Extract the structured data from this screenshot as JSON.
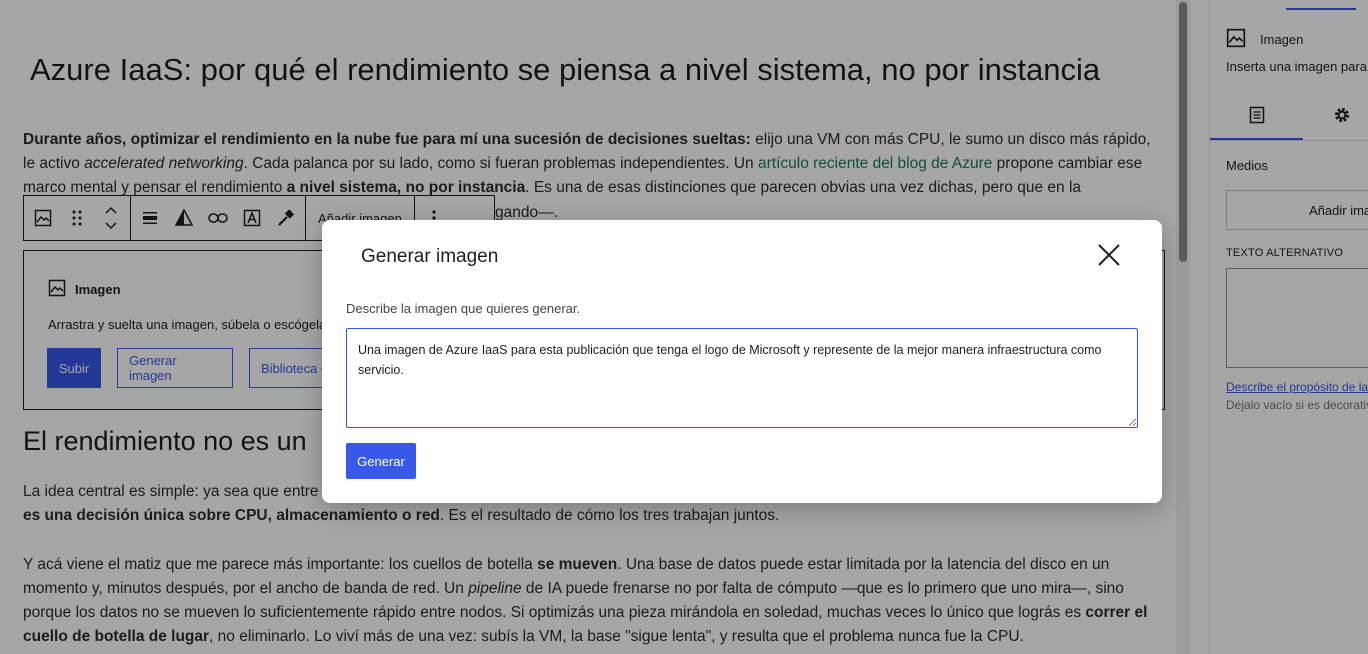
{
  "post": {
    "title": "Azure IaaS: por qué el rendimiento se piensa a nivel sistema, no por instancia",
    "p1": {
      "b1": "Durante años, optimizar el rendimiento en la nube fue para mí una sucesión de decisiones sueltas:",
      "t1": " elijo una VM con más CPU, le sumo un disco más rápido, le activo ",
      "i1": "accelerated networking",
      "t2": ". Cada palanca por su lado, como si fueran problemas independientes. Un ",
      "link": "artículo reciente del blog de Azure",
      "t3": " propone cambiar ese marco mental y pensar el rendimiento ",
      "b2": "a nivel sistema, no por instancia",
      "t4": ". Es una de esas distinciones que parecen obvias una vez dichas, pero que en la"
    },
    "p1_tail": "gando—.",
    "h2": "El rendimiento no es un",
    "p2": {
      "t1": "La idea central es simple: ya sea que entre",
      "b1": "es una decisión única sobre CPU, almacenamiento o red",
      "t2": ". Es el resultado de cómo los tres trabajan juntos."
    },
    "p3": {
      "t1": "Y acá viene el matiz que me parece más importante: los cuellos de botella ",
      "b1": "se mueven",
      "t2": ". Una base de datos puede estar limitada por la latencia del disco en un momento y, minutos después, por el ancho de banda de red. Un ",
      "i1": "pipeline",
      "t3": " de IA puede frenarse no por falta de cómputo —que es lo primero que uno mira—, sino porque los datos no se mueven lo suficientemente rápido entre nodos. Si optimizás una pieza mirándola en soledad, muchas veces lo único que lográs es ",
      "b2": "correr el cuello de botella de lugar",
      "t4": ", no eliminarlo. Lo viví más de una vez: subís la VM, la base \"sigue lenta\", y resulta que el problema nunca fue la CPU."
    }
  },
  "toolbar": {
    "add_image": "Añadir imagen"
  },
  "image_block": {
    "label": "Imagen",
    "instructions": "Arrastra y suelta una imagen, súbela o escógela",
    "upload": "Subir",
    "generate": "Generar imagen",
    "library": "Biblioteca d"
  },
  "sidebar": {
    "block_name": "Imagen",
    "block_desc": "Inserta una imagen para",
    "section": "Medios",
    "add_image": "Añadir ima",
    "alt_label": "TEXTO ALTERNATIVO",
    "alt_link": "Describe el propósito de la",
    "alt_help": "Déjalo vacío si es decorativ"
  },
  "modal": {
    "title": "Generar imagen",
    "label": "Describe la imagen que quieres generar.",
    "prompt": "Una imagen de Azure IaaS para esta publicación que tenga el logo de Microsoft y represente de la mejor manera infraestructura como servicio.",
    "generate": "Generar"
  },
  "colors": {
    "accent": "#3858e9",
    "link": "#1f7a57"
  }
}
